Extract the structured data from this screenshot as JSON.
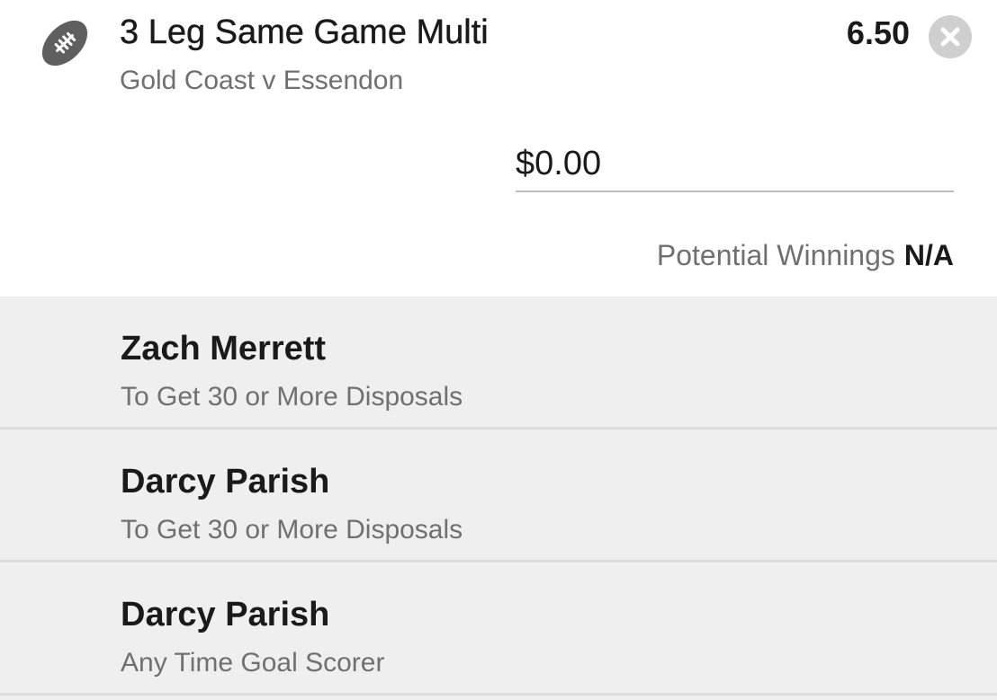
{
  "bet": {
    "title": "3 Leg Same Game Multi",
    "match": "Gold Coast v Essendon",
    "odds": "6.50",
    "sport_icon": "football-icon",
    "remove_icon": "close-icon"
  },
  "stake": {
    "value": "",
    "placeholder": "$0.00"
  },
  "winnings": {
    "label": "Potential Winnings",
    "value": "N/A"
  },
  "legs": [
    {
      "name": "Zach Merrett",
      "market": "To Get 30 or More Disposals"
    },
    {
      "name": "Darcy Parish",
      "market": "To Get 30 or More Disposals"
    },
    {
      "name": "Darcy Parish",
      "market": "Any Time Goal Scorer"
    }
  ],
  "colors": {
    "text_primary": "#1a1a1a",
    "text_secondary": "#707070",
    "legs_background": "#efefef",
    "divider": "#dcdcdc",
    "icon_gray": "#5f5f5f"
  }
}
